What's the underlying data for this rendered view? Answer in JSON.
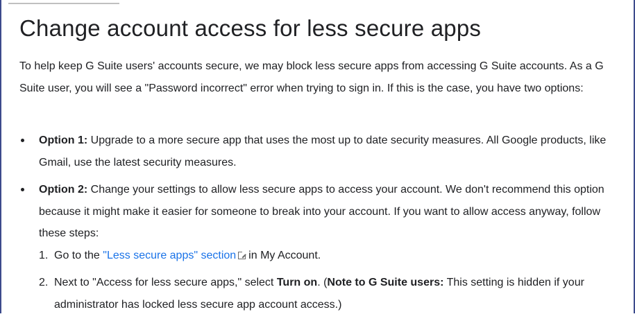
{
  "title": "Change account access for less secure apps",
  "intro": "To help keep G Suite users' accounts secure, we may block less secure apps from accessing G Suite accounts. As a G Suite user, you will see a \"Password incorrect\" error when trying to sign in. If this is the case, you have two options:",
  "options": [
    {
      "label": "Option 1:",
      "text": " Upgrade to a more secure app that uses the most up to date security measures. All Google products, like Gmail, use the latest security measures."
    },
    {
      "label": "Option 2:",
      "text": " Change your settings to allow less secure apps to access your account. We don't recommend this option because it might make it easier for someone to break into your account. If you want to allow access anyway, follow these steps:"
    }
  ],
  "steps": [
    {
      "num": "1.",
      "before": "Go to the ",
      "link": "\"Less secure apps\" section",
      "link_icon": "external-link-icon",
      "after": "in My Account."
    },
    {
      "num": "2.",
      "before": "Next to \"Access for less secure apps,\" select ",
      "bold": "Turn on",
      "mid": ". (",
      "note_label": "Note to G Suite users:",
      "after": " This setting is hidden if your administrator has locked less secure app account access.)"
    }
  ],
  "colors": {
    "link": "#1a73e8",
    "text": "#202124",
    "frame": "#3c4a8c"
  }
}
